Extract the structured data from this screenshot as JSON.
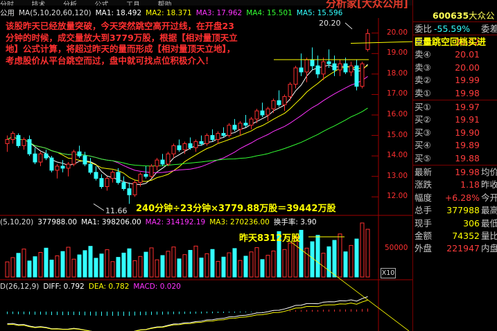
{
  "menu": {
    "items": [
      "分时",
      "技术",
      "分析",
      "公式",
      "工具",
      "帮助"
    ]
  },
  "brand": "分析家[大众公用]",
  "ma_line": {
    "name": "公用",
    "params": "MA(5,10,20,60,120)",
    "ma1": "MA1: 18.492",
    "ma2": "MA2: 18.371",
    "ma3": "MA3: 17.962",
    "ma4": "MA4: 15.501",
    "ma5": "MA5: 15.596"
  },
  "volume_line": {
    "params": "(5,10,20)",
    "value": "377988.00",
    "ma1": "MA1: 398206.00",
    "ma2": "MA2: 314192.19",
    "ma3": "MA3: 270236.00",
    "turnover": "换手率: 3.90"
  },
  "macd_line": {
    "params": "D(26,12,9)",
    "diff": "DIFF: 0.792",
    "dea": "DEA: 0.782",
    "macd": "MACD: 0.020"
  },
  "annotation": {
    "note": "该股昨天已经放量突破，今天突然跳空高开过线，在开盘23分钟的时候，成交量放大到3779万股，根据【相对量顶天立地】公式计算，将超过昨天的量而形成【相对量顶天立地】，考虑股价从平台跳空而过，盘中就可找点位积极介入！",
    "calc": "240分钟÷23分钟×3779.88万股＝39442万股",
    "yesterday": "昨天8312万股",
    "gap_callout": "巨量跳空回档买进",
    "low_label": "11.66",
    "high_label": "20.20"
  },
  "price_axis": [
    "20.00",
    "19.00",
    "18.00",
    "17.00",
    "16.00",
    "15.00",
    "14.00",
    "13.00",
    "12.00"
  ],
  "volume_axis": [
    "50000"
  ],
  "x10_label": "X10",
  "quote": {
    "code": "600635",
    "name": "大众公",
    "weibi_label": "委比",
    "weibi_value": "-55.59%",
    "weibi_trail": "委差",
    "sells": [
      {
        "label": "卖⑤",
        "price": "20.02"
      },
      {
        "label": "卖④",
        "price": "20.01"
      },
      {
        "label": "卖③",
        "price": "20.00"
      },
      {
        "label": "卖②",
        "price": "19.99"
      },
      {
        "label": "卖①",
        "price": "19.98"
      }
    ],
    "buys": [
      {
        "label": "买①",
        "price": "19.97"
      },
      {
        "label": "买②",
        "price": "19.91"
      },
      {
        "label": "买③",
        "price": "19.90"
      },
      {
        "label": "买④",
        "price": "19.89"
      },
      {
        "label": "买⑤",
        "price": "19.88"
      }
    ],
    "stats": [
      {
        "label": "最新",
        "value": "19.98",
        "trail": "均价",
        "color": "#ff3c3c"
      },
      {
        "label": "涨跌",
        "value": "1.18",
        "trail": "昨收",
        "color": "#ff3c3c"
      },
      {
        "label": "幅度",
        "value": "+6.28%",
        "trail": "今开",
        "color": "#ff3c3c"
      },
      {
        "label": "总手",
        "value": "377988",
        "trail": "最高",
        "color": "#ffff00"
      },
      {
        "label": "现手",
        "value": "306",
        "trail": "最低",
        "color": "#ffff00"
      },
      {
        "label": "金额",
        "value": "74352",
        "trail": "量比",
        "color": "#ffff00"
      },
      {
        "label": "外盘",
        "value": "221947",
        "trail": "内盘",
        "color": "#ff3c3c"
      }
    ]
  },
  "colors": {
    "up": "#ff3030",
    "down": "#33ffff",
    "ma1": "#ffffff",
    "ma2": "#ffff00",
    "ma3": "#ff33ff",
    "ma4": "#33ff33",
    "ma5": "#33ffff"
  },
  "chart_data": {
    "type": "candlestick",
    "ylim": [
      11.3,
      20.6
    ],
    "ohlc": [
      [
        14.6,
        15.0,
        14.2,
        14.8
      ],
      [
        14.8,
        15.2,
        14.6,
        15.1
      ],
      [
        15.0,
        15.1,
        14.4,
        14.5
      ],
      [
        14.5,
        14.9,
        14.3,
        14.8
      ],
      [
        14.8,
        15.0,
        14.0,
        14.1
      ],
      [
        14.1,
        14.4,
        13.6,
        13.7
      ],
      [
        13.7,
        14.2,
        13.5,
        14.1
      ],
      [
        14.1,
        14.3,
        13.8,
        13.9
      ],
      [
        13.9,
        14.0,
        13.2,
        13.3
      ],
      [
        13.3,
        13.6,
        12.9,
        13.5
      ],
      [
        13.5,
        13.8,
        13.2,
        13.4
      ],
      [
        13.4,
        13.7,
        13.0,
        13.6
      ],
      [
        13.6,
        14.3,
        13.5,
        14.2
      ],
      [
        14.2,
        14.5,
        13.9,
        14.0
      ],
      [
        14.0,
        14.2,
        13.5,
        13.6
      ],
      [
        13.6,
        13.9,
        13.1,
        13.2
      ],
      [
        13.2,
        13.5,
        12.8,
        12.9
      ],
      [
        12.9,
        13.1,
        12.4,
        12.5
      ],
      [
        12.5,
        13.0,
        12.3,
        12.9
      ],
      [
        12.9,
        13.3,
        12.7,
        13.2
      ],
      [
        13.2,
        13.4,
        12.6,
        12.7
      ],
      [
        12.7,
        13.0,
        12.3,
        12.4
      ],
      [
        12.4,
        12.7,
        11.66,
        12.1
      ],
      [
        12.1,
        12.8,
        12.0,
        12.7
      ],
      [
        12.7,
        13.2,
        12.5,
        13.1
      ],
      [
        13.1,
        13.5,
        12.9,
        13.0
      ],
      [
        13.0,
        13.6,
        12.9,
        13.5
      ],
      [
        13.5,
        13.9,
        13.3,
        13.8
      ],
      [
        13.8,
        14.1,
        13.5,
        13.6
      ],
      [
        13.6,
        14.2,
        13.5,
        14.1
      ],
      [
        14.1,
        14.6,
        13.9,
        14.5
      ],
      [
        14.5,
        14.8,
        14.2,
        14.3
      ],
      [
        14.3,
        14.7,
        14.1,
        14.6
      ],
      [
        14.6,
        14.9,
        14.3,
        14.4
      ],
      [
        14.4,
        14.8,
        14.2,
        14.7
      ],
      [
        14.7,
        15.0,
        14.5,
        14.6
      ],
      [
        14.6,
        15.1,
        14.5,
        15.0
      ],
      [
        15.0,
        15.3,
        14.7,
        14.8
      ],
      [
        14.8,
        15.2,
        14.6,
        15.1
      ],
      [
        15.1,
        15.4,
        14.9,
        15.0
      ],
      [
        15.0,
        15.6,
        14.9,
        15.5
      ],
      [
        15.5,
        15.8,
        15.2,
        15.3
      ],
      [
        15.3,
        15.7,
        15.0,
        15.6
      ],
      [
        15.6,
        16.0,
        15.4,
        15.5
      ],
      [
        15.5,
        15.9,
        15.3,
        15.8
      ],
      [
        15.8,
        16.3,
        15.6,
        16.2
      ],
      [
        16.2,
        16.6,
        15.9,
        16.0
      ],
      [
        16.0,
        16.4,
        15.7,
        16.3
      ],
      [
        16.3,
        16.8,
        16.1,
        16.7
      ],
      [
        16.7,
        17.2,
        16.4,
        16.5
      ],
      [
        16.5,
        17.0,
        16.2,
        16.9
      ],
      [
        16.9,
        17.6,
        16.7,
        17.5
      ],
      [
        17.5,
        18.4,
        17.3,
        18.3
      ],
      [
        18.3,
        19.0,
        17.9,
        18.1
      ],
      [
        18.1,
        18.8,
        17.6,
        18.7
      ],
      [
        18.7,
        19.3,
        18.2,
        18.4
      ],
      [
        18.4,
        18.9,
        17.8,
        18.0
      ],
      [
        18.0,
        18.8,
        17.7,
        18.6
      ],
      [
        18.6,
        19.2,
        18.3,
        18.5
      ],
      [
        18.5,
        18.9,
        17.9,
        18.2
      ],
      [
        18.2,
        18.7,
        17.9,
        18.5
      ],
      [
        18.5,
        18.8,
        18.0,
        18.1
      ],
      [
        18.1,
        18.6,
        17.9,
        18.4
      ],
      [
        18.4,
        18.7,
        17.2,
        17.4
      ],
      [
        17.4,
        18.6,
        17.3,
        18.5
      ],
      [
        19.2,
        20.2,
        19.1,
        19.98
      ]
    ],
    "volume_max": 100000,
    "macd_range": [
      -1.5,
      1.0
    ]
  }
}
